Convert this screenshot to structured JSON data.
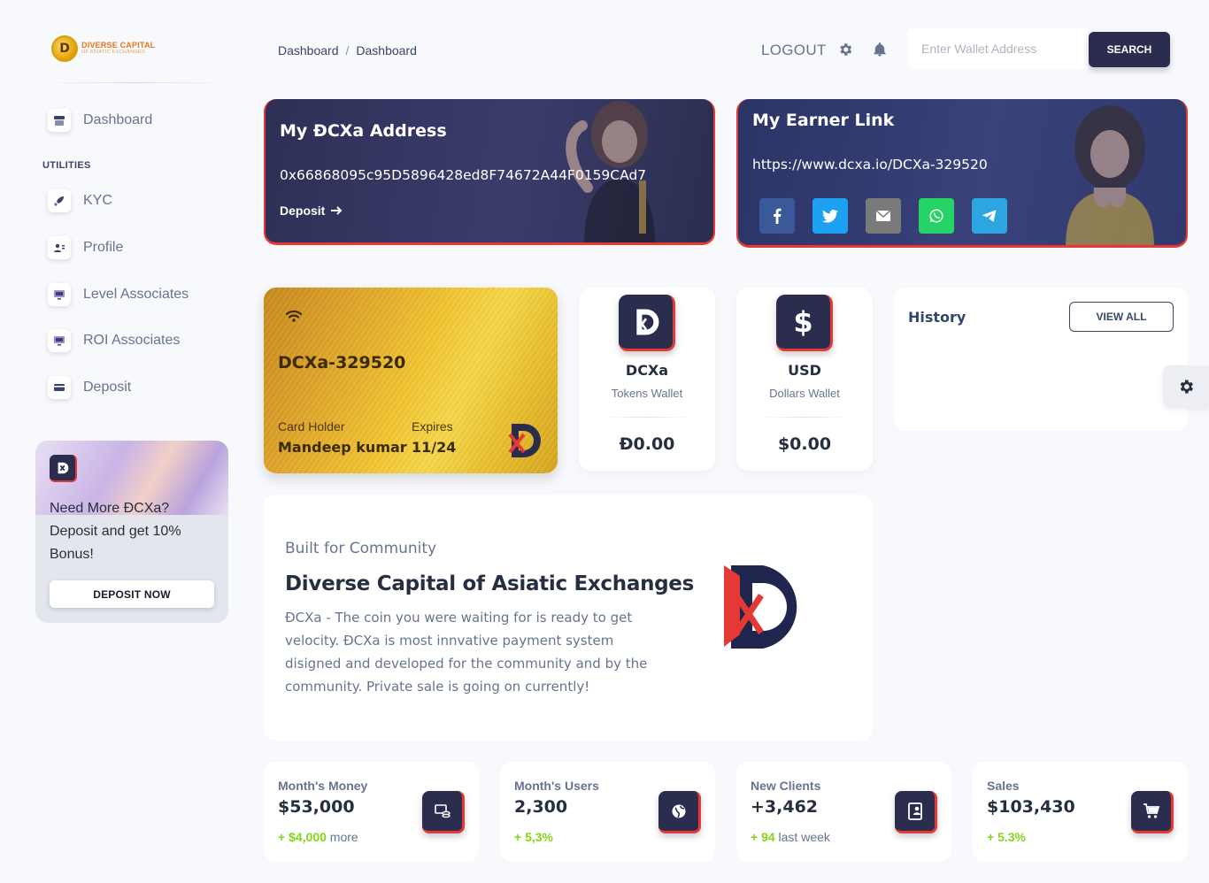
{
  "brand": {
    "line1": "DIVERSE CAPITAL",
    "line2": "OF ASIATIC EXCHANGES",
    "coin_letter": "D"
  },
  "sidebar": {
    "items": [
      {
        "label": "Dashboard",
        "icon": "shop-icon"
      },
      {
        "label": "KYC",
        "icon": "rocket-icon"
      },
      {
        "label": "Profile",
        "icon": "id-card-icon"
      },
      {
        "label": "Level Associates",
        "icon": "monitor-icon"
      },
      {
        "label": "ROI Associates",
        "icon": "monitor-icon"
      },
      {
        "label": "Deposit",
        "icon": "credit-card-icon"
      }
    ],
    "section_label": "UTILITIES",
    "promo": {
      "text": "Need More ĐCXa? Deposit and get 10% Bonus!",
      "button": "DEPOSIT NOW"
    }
  },
  "header": {
    "breadcrumb": [
      "Dashboard",
      "Dashboard"
    ],
    "breadcrumb_sep": "/",
    "logout": "LOGOUT",
    "search_placeholder": "Enter Wallet Address",
    "search_button": "SEARCH"
  },
  "address_card": {
    "title": "My ĐCXa Address",
    "address": "0x66868095c95D5896428ed8F74672A44F0159CAd7",
    "link": "Deposit"
  },
  "earner_card": {
    "title": "My Earner Link",
    "url": "https://www.dcxa.io/DCXa-329520",
    "share": [
      {
        "name": "facebook-icon",
        "color": "#3b5998"
      },
      {
        "name": "twitter-icon",
        "color": "#1da1f2"
      },
      {
        "name": "email-icon",
        "color": "#7a7a7a"
      },
      {
        "name": "whatsapp-icon",
        "color": "#25d366"
      },
      {
        "name": "telegram-icon",
        "color": "#2ca5e0"
      }
    ]
  },
  "gold_card": {
    "card_id": "DCXa-329520",
    "holder_label": "Card Holder",
    "holder": "Mandeep kumar",
    "expires_label": "Expires",
    "expires": "11/24"
  },
  "wallets": [
    {
      "title": "DCXa",
      "subtitle": "Tokens Wallet",
      "value": "Đ0.00"
    },
    {
      "title": "USD",
      "subtitle": "Dollars Wallet",
      "value": "$0.00"
    }
  ],
  "history": {
    "title": "History",
    "button": "VIEW ALL"
  },
  "info": {
    "kicker": "Built for Community",
    "title": "Diverse Capital of Asiatic Exchanges",
    "body": "ĐCXa - The coin you were waiting for is ready to get velocity. ĐCXa is most innvative payment system disigned and developed for the community and by the community. Private sale is going on currently!"
  },
  "stats": [
    {
      "label": "Month's Money",
      "value": "$53,000",
      "delta": "+ $4,000",
      "suffix": " more",
      "icon": "money-coins-icon"
    },
    {
      "label": "Month's Users",
      "value": "2,300",
      "delta": "+ 5,3%",
      "suffix": "",
      "icon": "globe-icon"
    },
    {
      "label": "New Clients",
      "value": "+3,462",
      "delta": "+ 94",
      "suffix": " last week",
      "icon": "contact-book-icon"
    },
    {
      "label": "Sales",
      "value": "$103,430",
      "delta": "+ 5.3%",
      "suffix": "",
      "icon": "cart-icon"
    }
  ],
  "colors": {
    "primary": "#2b2d4f",
    "accent": "#e53935",
    "success": "#82d616",
    "gold": "#f2c531"
  }
}
